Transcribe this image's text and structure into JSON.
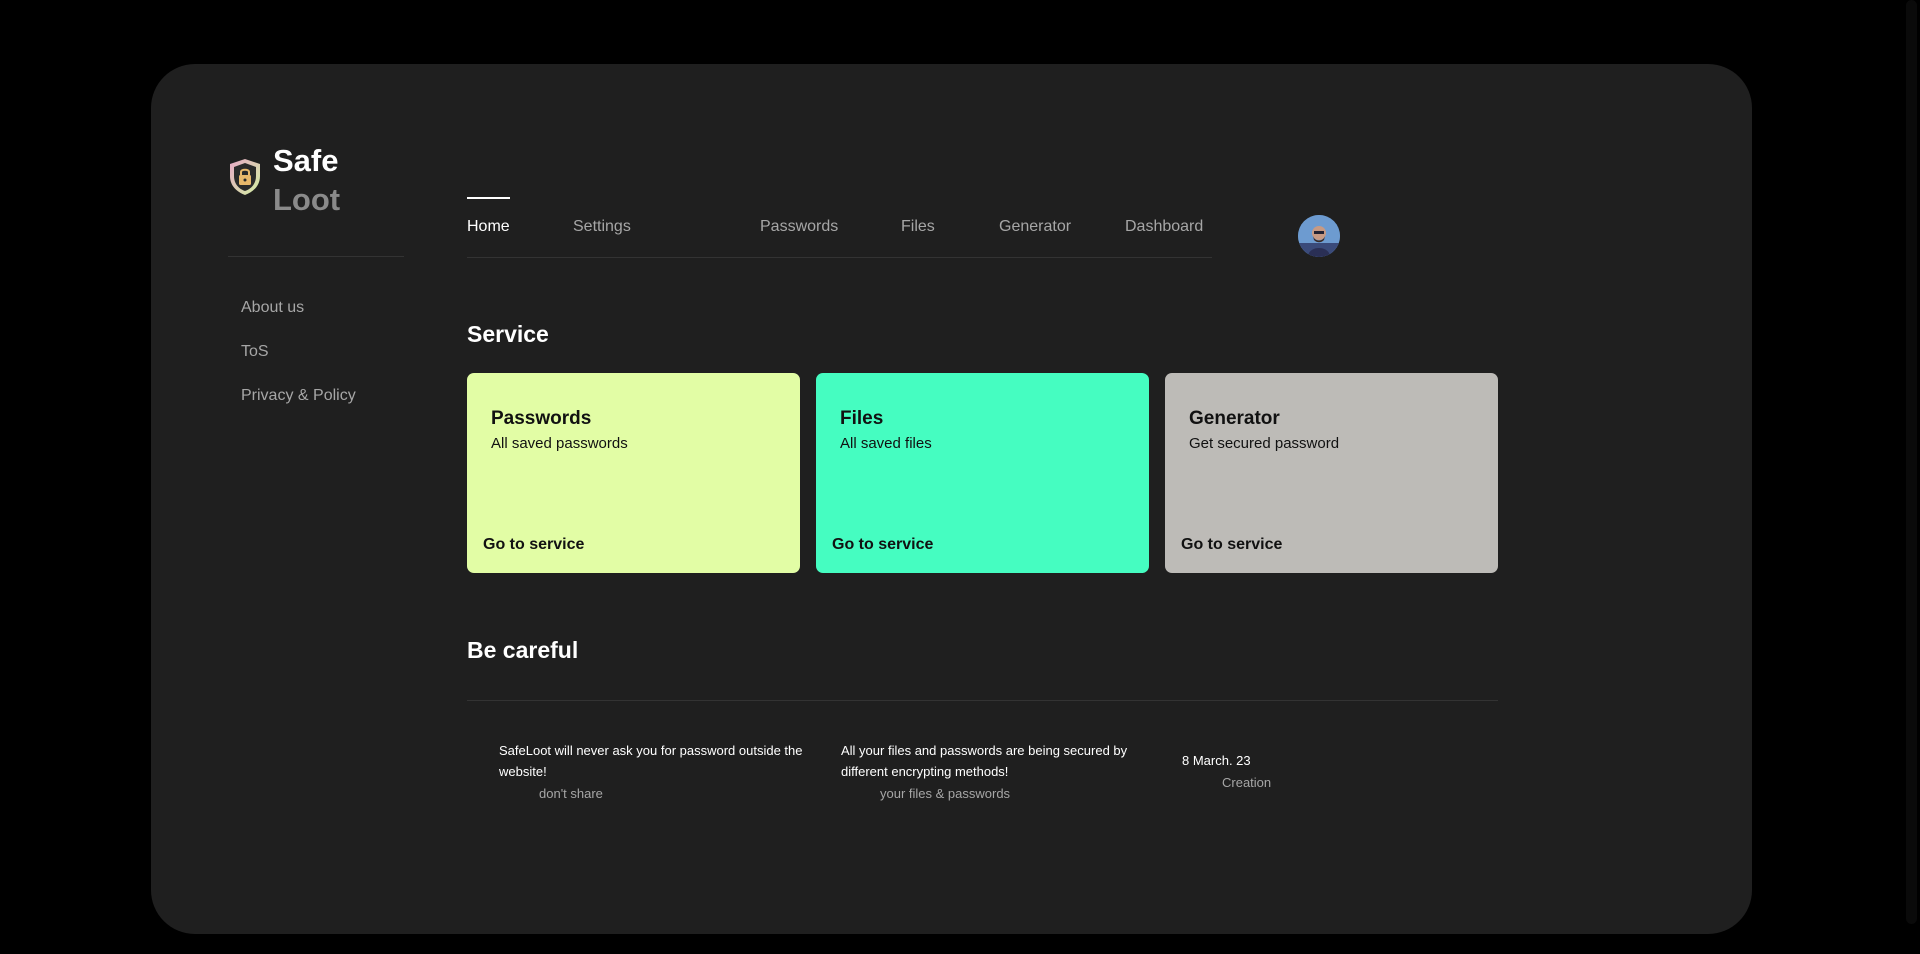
{
  "logo": {
    "line1": "Safe",
    "line2": "Loot",
    "icon": "shield-lock-icon"
  },
  "sidebar": {
    "links": [
      {
        "label": "About us"
      },
      {
        "label": "ToS"
      },
      {
        "label": "Privacy & Policy"
      }
    ]
  },
  "nav": {
    "items": [
      {
        "label": "Home",
        "active": true
      },
      {
        "label": "Settings"
      },
      {
        "label": "Passwords"
      },
      {
        "label": "Files"
      },
      {
        "label": "Generator"
      },
      {
        "label": "Dashboard"
      }
    ]
  },
  "service": {
    "title": "Service",
    "cards": [
      {
        "title": "Passwords",
        "desc": "All saved passwords",
        "link": "Go to service",
        "color": "#e2fda5"
      },
      {
        "title": "Files",
        "desc": "All saved files",
        "link": "Go to service",
        "color": "#45fdc1"
      },
      {
        "title": "Generator",
        "desc": "Get secured password",
        "link": "Go to service",
        "color": "#bdbbb7"
      }
    ]
  },
  "careful": {
    "title": "Be careful",
    "items": [
      {
        "text": "SafeLoot will never ask you for password outside the website!",
        "sub": "don't share"
      },
      {
        "text": "All your files and passwords are being secured by different encrypting methods!",
        "sub": "your files & passwords"
      },
      {
        "text": "8 March. 23",
        "sub": "Creation"
      }
    ]
  },
  "colors": {
    "window_bg": "#1f1f1f",
    "page_bg": "#000000",
    "muted_text": "#a6a6a6"
  }
}
